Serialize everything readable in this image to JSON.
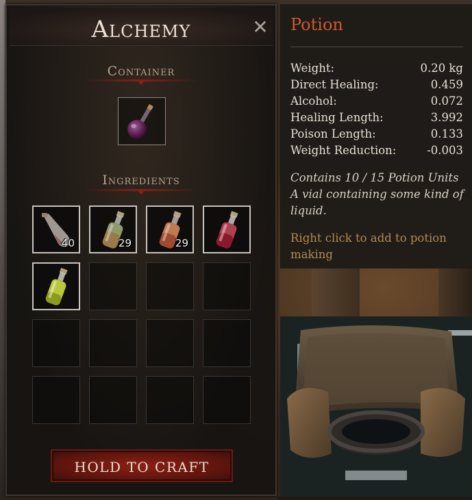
{
  "alchemy": {
    "title": "Alchemy",
    "close_icon": "✕",
    "container_heading": "Container",
    "ingredients_heading": "Ingredients",
    "container_item": {
      "icon": "round-flask-purple-icon"
    },
    "ingredients": [
      {
        "icon": "bottle-clear-icon",
        "count": "40"
      },
      {
        "icon": "bottle-green-icon",
        "count": "29"
      },
      {
        "icon": "bottle-orange-icon",
        "count": "29"
      },
      {
        "icon": "bottle-red-icon",
        "count": ""
      },
      {
        "icon": "bottle-yellow-icon",
        "count": ""
      }
    ],
    "craft_label": "HOLD TO CRAFT"
  },
  "tooltip": {
    "title": "Potion",
    "title_color": "#d0582c",
    "stats": [
      {
        "label": "Weight:",
        "value": "0.20 kg"
      },
      {
        "label": "Direct Healing:",
        "value": "0.459"
      },
      {
        "label": "Alcohol:",
        "value": "0.072"
      },
      {
        "label": "Healing Length:",
        "value": "3.992"
      },
      {
        "label": "Poison Length:",
        "value": "0.133"
      },
      {
        "label": "Weight Reduction:",
        "value": "-0.003"
      }
    ],
    "units_line": "Contains 10 / 15 Potion Units",
    "description": "A vial containing some kind of liquid.",
    "hint": "Right click to add to potion making"
  }
}
